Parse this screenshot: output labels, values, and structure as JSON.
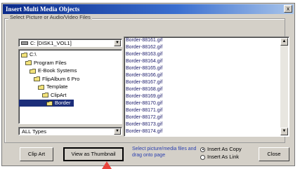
{
  "dialog": {
    "title": "Insert Multi Media Objects",
    "close_glyph": "x"
  },
  "group": {
    "label": "Select Picture or Audio/Video Files"
  },
  "drive": {
    "value": "C: [DISK1_VOL1]",
    "icon": "drive-icon"
  },
  "folders": [
    {
      "label": "C:\\",
      "indent": 0,
      "selected": false
    },
    {
      "label": "Program Files",
      "indent": 1,
      "selected": false
    },
    {
      "label": "E-Book Systems",
      "indent": 2,
      "selected": false
    },
    {
      "label": "FlipAlbum 6 Pro",
      "indent": 3,
      "selected": false
    },
    {
      "label": "Template",
      "indent": 4,
      "selected": false
    },
    {
      "label": "ClipArt",
      "indent": 5,
      "selected": false
    },
    {
      "label": "Border",
      "indent": 6,
      "selected": true
    }
  ],
  "file_type": {
    "value": "ALL Types"
  },
  "files": [
    "Border-88161.gif",
    "Border-88162.gif",
    "Border-88163.gif",
    "Border-88164.gif",
    "Border-88165.gif",
    "Border-88166.gif",
    "Border-88167.gif",
    "Border-88168.gif",
    "Border-88169.gif",
    "Border-88170.gif",
    "Border-88171.gif",
    "Border-88172.gif",
    "Border-88173.gif",
    "Border-88174.gif"
  ],
  "buttons": {
    "clip_art": "Clip Art",
    "view_thumbnail": "View as Thumbnail",
    "close": "Close"
  },
  "hint": "Select picture/media files and drag onto page",
  "insert_mode": {
    "copy": "Insert As Copy",
    "link": "Insert As Link",
    "selected": "copy"
  },
  "colors": {
    "selection": "#1c2e7a",
    "hint_text": "#2a3fb0",
    "pointer": "#e8433a"
  }
}
